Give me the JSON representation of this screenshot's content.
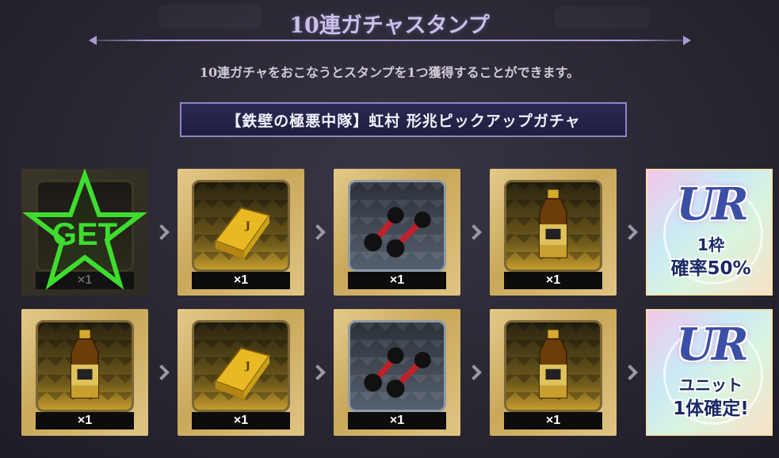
{
  "title": "10連ガチャスタンプ",
  "subtitle": "10連ガチャをおこなうとスタンプを1つ獲得することができます。",
  "gacha_name": "【鉄壁の極悪中隊】虹村 形兆ピックアップガチャ",
  "get_text": "GET",
  "rows": [
    {
      "stamps": [
        {
          "item": "stamp-achieved",
          "count": "×1"
        },
        {
          "item": "gold-bar",
          "count": "×1"
        },
        {
          "item": "dumbbell",
          "count": "×1"
        },
        {
          "item": "energy-drink",
          "count": "×1"
        }
      ],
      "reward": {
        "logo": "UR",
        "line1": "1枠",
        "line2": "確率50%"
      }
    },
    {
      "stamps": [
        {
          "item": "energy-drink",
          "count": "×1"
        },
        {
          "item": "gold-bar",
          "count": "×1"
        },
        {
          "item": "dumbbell",
          "count": "×1"
        },
        {
          "item": "energy-drink",
          "count": "×1"
        }
      ],
      "reward": {
        "logo": "UR",
        "line1": "ユニット",
        "line2": "1体確定!"
      }
    }
  ],
  "colors": {
    "accent": "#a79ad3",
    "get_green": "#3ddc2e",
    "card_gold": "#c9a85a"
  }
}
